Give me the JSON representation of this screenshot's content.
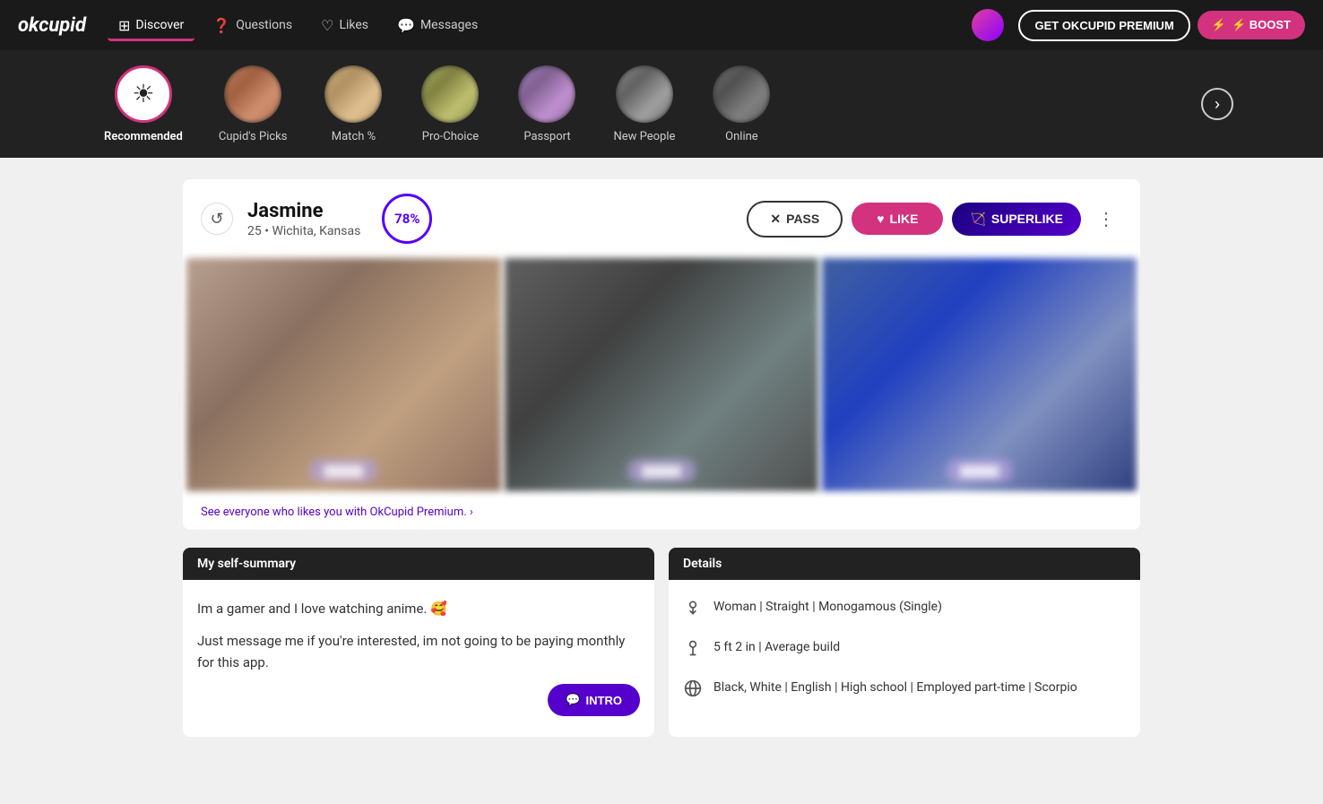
{
  "logo": "okcupid",
  "nav": {
    "items": [
      {
        "id": "discover",
        "label": "Discover",
        "icon": "⊞",
        "active": true
      },
      {
        "id": "questions",
        "label": "Questions",
        "icon": "❓"
      },
      {
        "id": "likes",
        "label": "Likes",
        "icon": "♡"
      },
      {
        "id": "messages",
        "label": "Messages",
        "icon": "💬"
      }
    ],
    "premium_btn": "GET OKCUPID PREMIUM",
    "boost_btn": "⚡ BOOST"
  },
  "categories": [
    {
      "id": "recommended",
      "label": "Recommended",
      "active": true,
      "icon_type": "sun"
    },
    {
      "id": "cupids-picks",
      "label": "Cupid's Picks",
      "active": false
    },
    {
      "id": "match",
      "label": "Match %",
      "active": false
    },
    {
      "id": "pro-choice",
      "label": "Pro-Choice",
      "active": false
    },
    {
      "id": "passport",
      "label": "Passport",
      "active": false
    },
    {
      "id": "new-people",
      "label": "New People",
      "active": false
    },
    {
      "id": "online",
      "label": "Online",
      "active": false
    }
  ],
  "profile": {
    "name": "Jasmine",
    "age": "25",
    "location": "Wichita, Kansas",
    "match_percent": "78%",
    "actions": {
      "pass": "PASS",
      "like": "LIKE",
      "superlike": "SUPERLIKE"
    },
    "premium_prompt": "See everyone who likes you with OkCupid Premium. ›",
    "self_summary": {
      "header": "My self-summary",
      "text1": "Im a gamer and I love watching anime. 🥰",
      "text2": "Just message me if you're interested, im not going to be paying monthly for this app.",
      "intro_btn": "INTRO"
    },
    "details": {
      "header": "Details",
      "orientation": "Woman | Straight | Monogamous (Single)",
      "height": "5 ft 2 in | Average build",
      "background": "Black, White | English | High school | Employed part-time | Scorpio"
    }
  }
}
